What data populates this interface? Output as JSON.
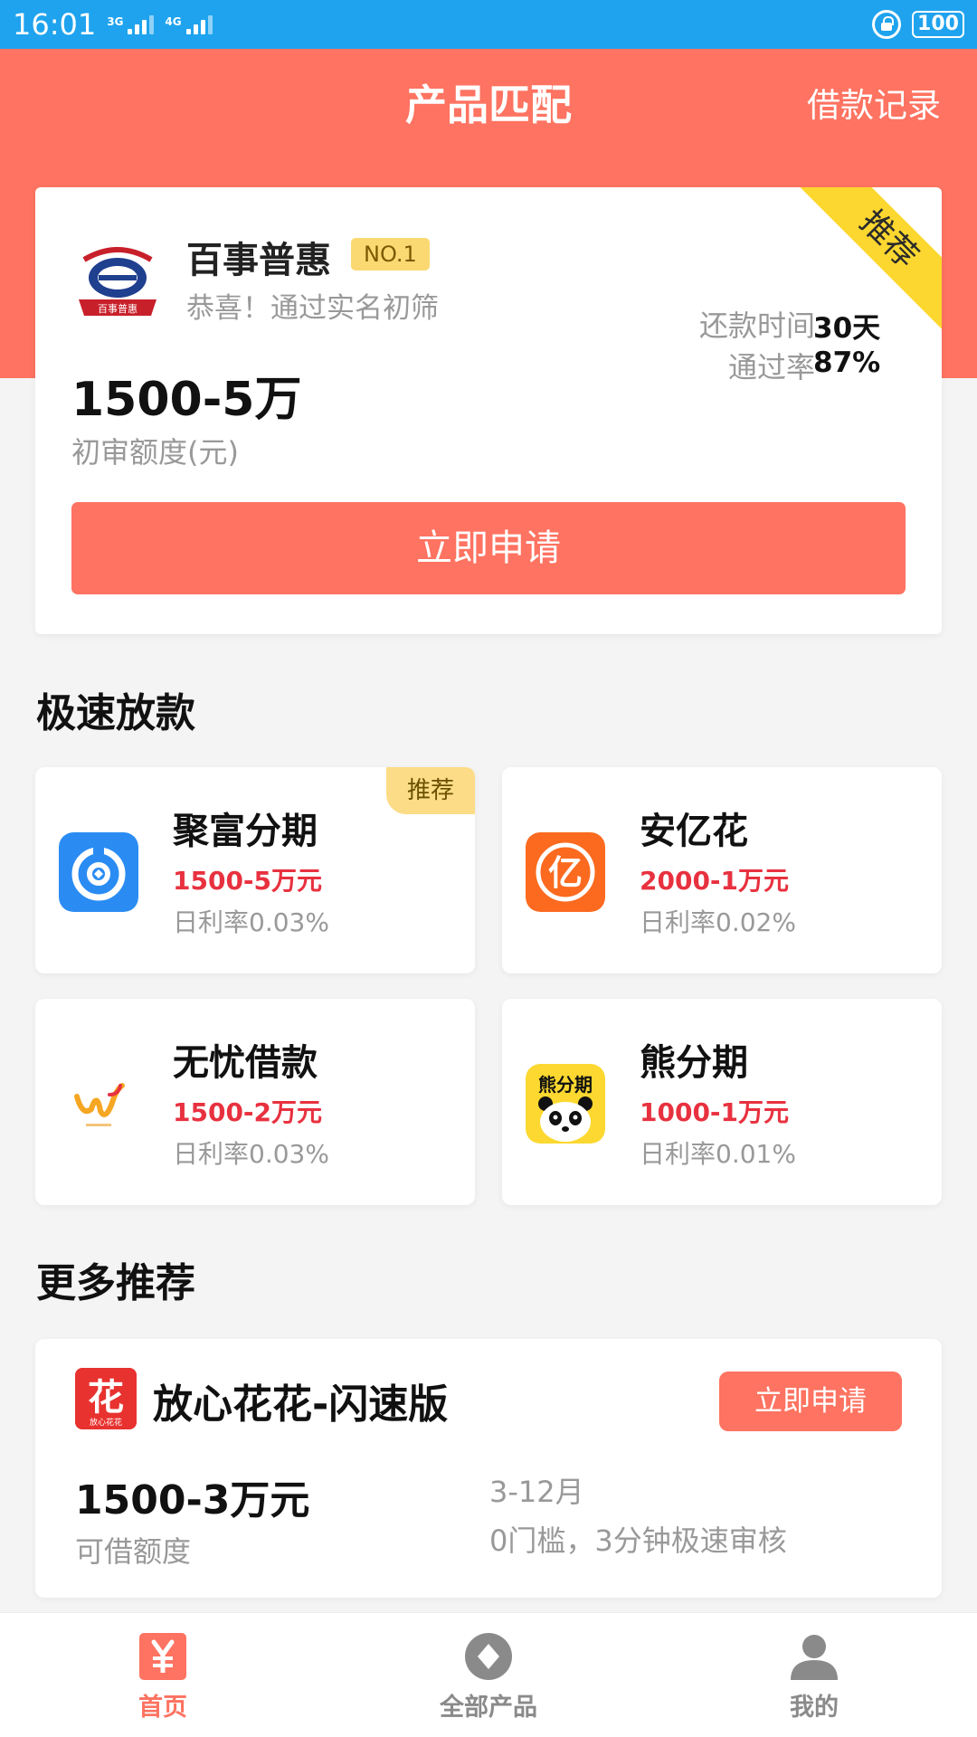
{
  "status_bar": {
    "time": "16:01",
    "network_1": "3G",
    "network_2": "4G",
    "battery": "100"
  },
  "header": {
    "title": "产品匹配",
    "loan_record": "借款记录"
  },
  "featured": {
    "ribbon": "推荐",
    "name": "百事普惠",
    "badge": "NO.1",
    "subtitle": "恭喜！通过实名初筛",
    "logo_text": "百事普惠",
    "amount": "1500-5万",
    "amount_label": "初审额度(元)",
    "repay_label": "还款时间",
    "repay_value": "30天",
    "pass_label": "通过率",
    "pass_value": "87%",
    "apply": "立即申请"
  },
  "fast_section": {
    "title": "极速放款",
    "items": [
      {
        "name": "聚富分期",
        "range": "1500-5万元",
        "rate": "日利率0.03%",
        "tag": "推荐"
      },
      {
        "name": "安亿花",
        "range": "2000-1万元",
        "rate": "日利率0.02%",
        "icon_char": "亿"
      },
      {
        "name": "无忧借款",
        "range": "1500-2万元",
        "rate": "日利率0.03%"
      },
      {
        "name": "熊分期",
        "range": "1000-1万元",
        "rate": "日利率0.01%",
        "icon_text": "熊分期"
      }
    ]
  },
  "more_section": {
    "title": "更多推荐",
    "item": {
      "logo_char": "花",
      "logo_sub": "放心花花",
      "name": "放心花花-闪速版",
      "apply": "立即申请",
      "amount": "1500-3万元",
      "amount_label": "可借额度",
      "term": "3-12月",
      "desc": "0门槛，3分钟极速审核"
    }
  },
  "tabs": [
    {
      "label": "首页",
      "active": true
    },
    {
      "label": "全部产品",
      "active": false
    },
    {
      "label": "我的",
      "active": false
    }
  ],
  "colors": {
    "status_bar": "#1fa3ee",
    "primary": "#fe7361",
    "range_red": "#e8313f",
    "badge_yellow": "#fbd972"
  }
}
